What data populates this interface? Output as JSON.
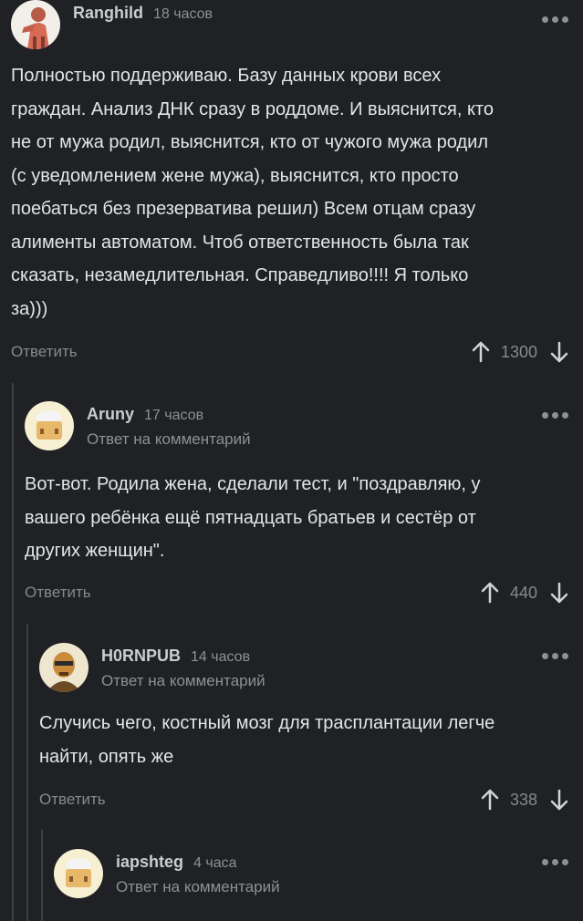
{
  "comments": [
    {
      "username": "Ranghild",
      "time": "18 часов",
      "reply_label": "",
      "text": "Полностью поддерживаю. Базу данных крови всех\nграждан. Анализ ДНК сразу в роддоме. И выяснится, кто\nне от мужа родил, выяснится, кто от чужого мужа родил\n(с уведомлением жене мужа), выяснится, кто просто\nпоебаться без презерватива решил) Всем отцам сразу\nалименты автоматом. Чтоб ответственность была так\nсказать, незамедлительная. Справедливо!!!! Я только\nза)))",
      "reply_button": "Ответить",
      "score": "1300"
    },
    {
      "username": "Aruny",
      "time": "17 часов",
      "reply_label": "Ответ на комментарий",
      "text": "Вот-вот. Родила жена, сделали тест, и \"поздравляю, у\nвашего ребёнка ещё пятнадцать братьев и сестёр от\nдругих женщин\".",
      "reply_button": "Ответить",
      "score": "440"
    },
    {
      "username": "H0RNPUB",
      "time": "14 часов",
      "reply_label": "Ответ на комментарий",
      "text": "Случись чего, костный мозг для трасплантации легче\nнайти, опять же",
      "reply_button": "Ответить",
      "score": "338"
    },
    {
      "username": "iapshteg",
      "time": "4 часа",
      "reply_label": "Ответ на комментарий",
      "text": "",
      "reply_button": "",
      "score": ""
    }
  ],
  "icons": {
    "upvote": "arrow-up-icon",
    "downvote": "arrow-down-icon",
    "more": "more-dots-icon"
  },
  "colors": {
    "background": "#1f2124",
    "text": "#e3e5e8",
    "muted": "#8d9196",
    "thread_line": "#3b3e42"
  }
}
